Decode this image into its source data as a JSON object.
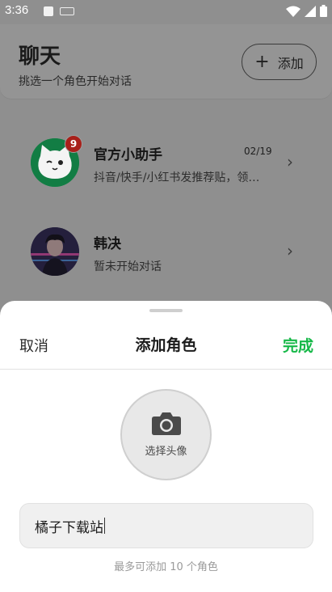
{
  "status_bar": {
    "time": "3:36"
  },
  "header": {
    "title": "聊天",
    "subtitle": "挑选一个角色开始对话",
    "add_button_label": "添加",
    "add_button_icon": "plus-icon"
  },
  "conversations": [
    {
      "name": "官方小助手",
      "date": "02/19",
      "preview": "抖音/快手/小红书发推荐贴，领…",
      "unread": "9",
      "avatar_icon": "cat-mascot-avatar",
      "avatar_color": "#1fb861"
    },
    {
      "name": "韩决",
      "date": "",
      "preview": "暂未开始对话",
      "unread": "",
      "avatar_icon": "character-portrait-avatar",
      "avatar_color": "#2b2446"
    }
  ],
  "sheet": {
    "cancel_label": "取消",
    "title": "添加角色",
    "done_label": "完成",
    "done_color": "#16b848",
    "avatar_picker_label": "选择头像",
    "avatar_picker_icon": "camera-icon",
    "name_input_value": "橘子下载站",
    "hint": "最多可添加 10 个角色"
  }
}
